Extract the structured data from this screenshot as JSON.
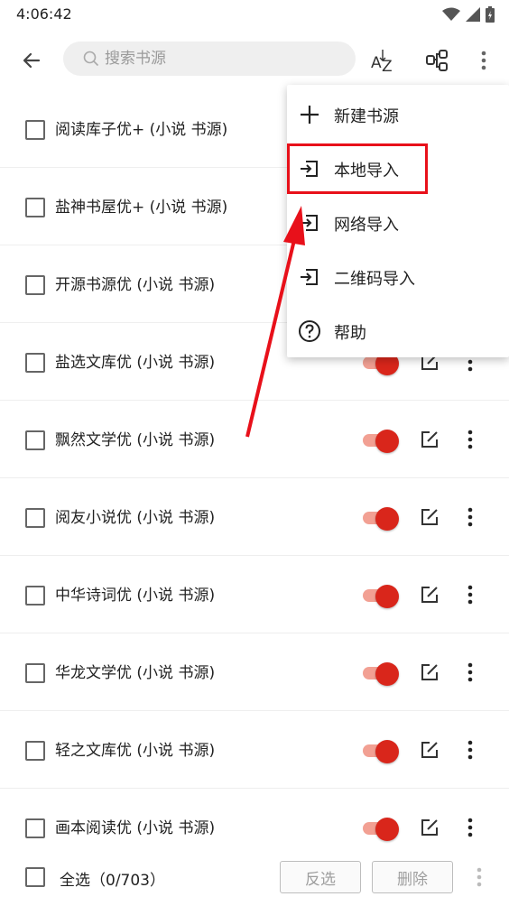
{
  "status_bar": {
    "time": "4:06:42"
  },
  "toolbar": {
    "search_placeholder": "搜索书源",
    "sort_icon": "sort-az-icon",
    "group_icon": "group-icon"
  },
  "sources": [
    {
      "name": "阅读库子优+ (小说 书源)",
      "enabled": true
    },
    {
      "name": "盐神书屋优+ (小说 书源)",
      "enabled": true
    },
    {
      "name": "开源书源优 (小说 书源)",
      "enabled": true
    },
    {
      "name": "盐选文库优 (小说 书源)",
      "enabled": true
    },
    {
      "name": "飘然文学优 (小说 书源)",
      "enabled": true
    },
    {
      "name": "阅友小说优 (小说 书源)",
      "enabled": true
    },
    {
      "name": "中华诗词优 (小说 书源)",
      "enabled": true
    },
    {
      "name": "华龙文学优 (小说 书源)",
      "enabled": true
    },
    {
      "name": "轻之文库优 (小说 书源)",
      "enabled": true
    },
    {
      "name": "画本阅读优 (小说 书源)",
      "enabled": true
    }
  ],
  "menu": {
    "items": [
      {
        "label": "新建书源",
        "icon": "plus-icon"
      },
      {
        "label": "本地导入",
        "icon": "import-icon"
      },
      {
        "label": "网络导入",
        "icon": "import-icon"
      },
      {
        "label": "二维码导入",
        "icon": "import-icon"
      },
      {
        "label": "帮助",
        "icon": "help-icon"
      }
    ],
    "highlighted_index": 1
  },
  "bottom_bar": {
    "select_all_label": "全选（0/703）",
    "invert_label": "反选",
    "delete_label": "删除"
  },
  "colors": {
    "accent": "#d9261b",
    "switch_track": "#f2a093",
    "annotation": "#e8101a"
  }
}
